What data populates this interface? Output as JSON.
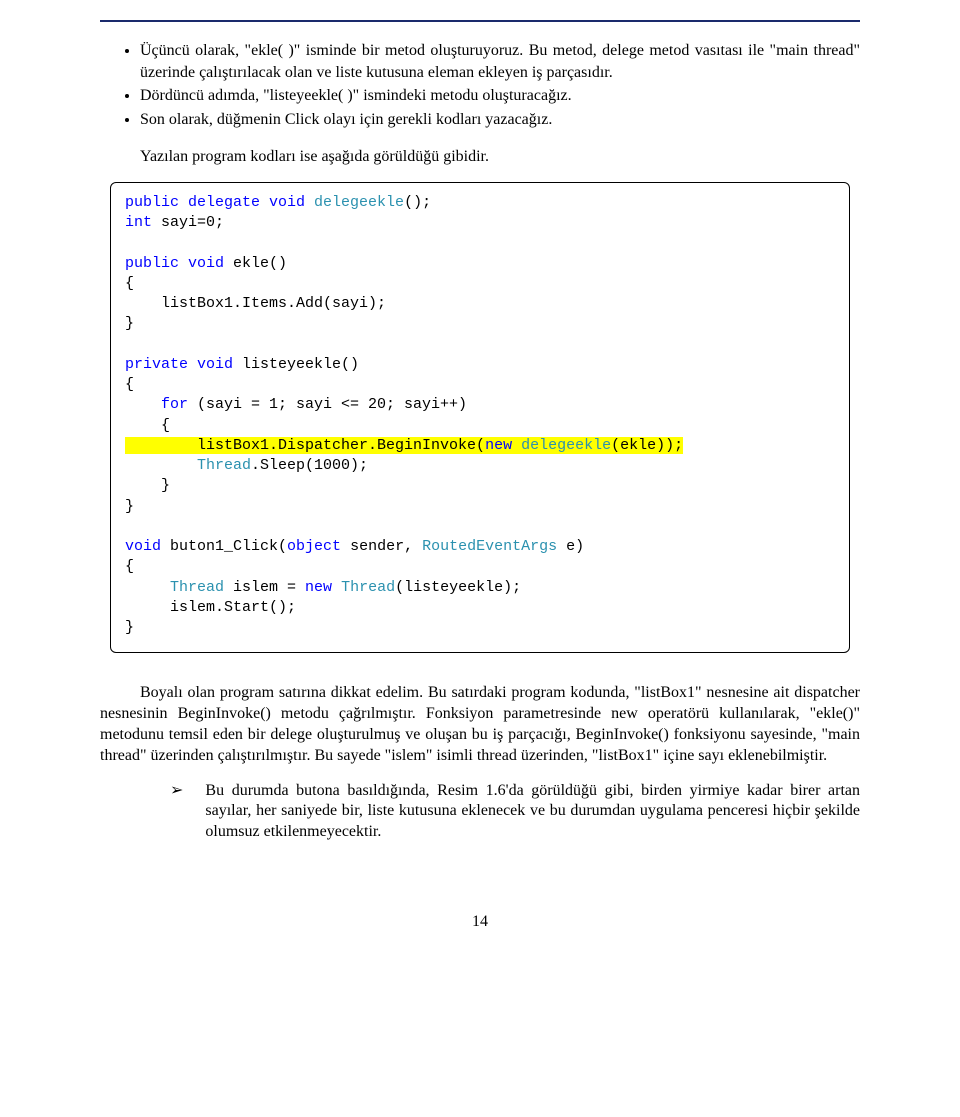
{
  "bullets": [
    "Üçüncü olarak, \"ekle( )\" isminde bir metod oluşturuyoruz. Bu metod, delege metod vasıtası ile \"main thread\" üzerinde çalıştırılacak olan ve liste kutusuna eleman ekleyen iş parçasıdır.",
    "Dördüncü adımda, \"listeyeekle( )\" ismindeki metodu oluşturacağız.",
    "Son olarak, düğmenin Click olayı için gerekli kodları yazacağız."
  ],
  "intro_para": "Yazılan program kodları ise aşağıda görüldüğü gibidir.",
  "code": {
    "l1a": "public",
    "l1b": " delegate",
    "l1c": " void",
    "l1d": " delegeekle",
    "l1e": "();",
    "l2a": "int",
    "l2b": " sayi=0;",
    "l3a": "public",
    "l3b": " void",
    "l3c": " ekle()",
    "l4": "{",
    "l5": "    listBox1.Items.Add(sayi);",
    "l6": "}",
    "l7a": "private",
    "l7b": " void",
    "l7c": " listeyeekle()",
    "l8": "{",
    "l9a": "    for",
    "l9b": " (sayi = 1; sayi <= 20; sayi++)",
    "l10": "    {",
    "l11a": "        listBox1.Dispatcher.BeginInvoke(",
    "l11b": "new",
    "l11c": " delegeekle",
    "l11d": "(ekle));",
    "l12a": "        Thread",
    "l12b": ".Sleep(1000);",
    "l13": "    }",
    "l14": "}",
    "l15a": "void",
    "l15b": " buton1_Click(",
    "l15c": "object",
    "l15d": " sender, ",
    "l15e": "RoutedEventArgs",
    "l15f": " e)",
    "l16": "{",
    "l17a": "     Thread",
    "l17b": " islem = ",
    "l17c": "new",
    "l17d": " Thread",
    "l17e": "(listeyeekle);",
    "l18": "     islem.Start();",
    "l19": "}"
  },
  "body_para": "Boyalı olan program satırına dikkat edelim. Bu satırdaki program kodunda, \"listBox1\" nesnesine ait dispatcher nesnesinin BeginInvoke() metodu çağrılmıştır. Fonksiyon parametresinde new operatörü kullanılarak, \"ekle()\" metodunu temsil eden bir delege oluşturulmuş ve oluşan bu iş parçacığı, BeginInvoke() fonksiyonu sayesinde, \"main thread\" üzerinden çalıştırılmıştır. Bu sayede \"islem\" isimli thread üzerinden, \"listBox1\" içine sayı eklenebilmiştir.",
  "arrow_item": "Bu durumda butona basıldığında, Resim 1.6'da görüldüğü gibi, birden yirmiye kadar birer artan sayılar, her saniyede bir, liste kutusuna eklenecek ve bu durumdan uygulama penceresi hiçbir şekilde olumsuz etkilenmeyecektir.",
  "arrow_symbol": "➢",
  "page_number": "14"
}
